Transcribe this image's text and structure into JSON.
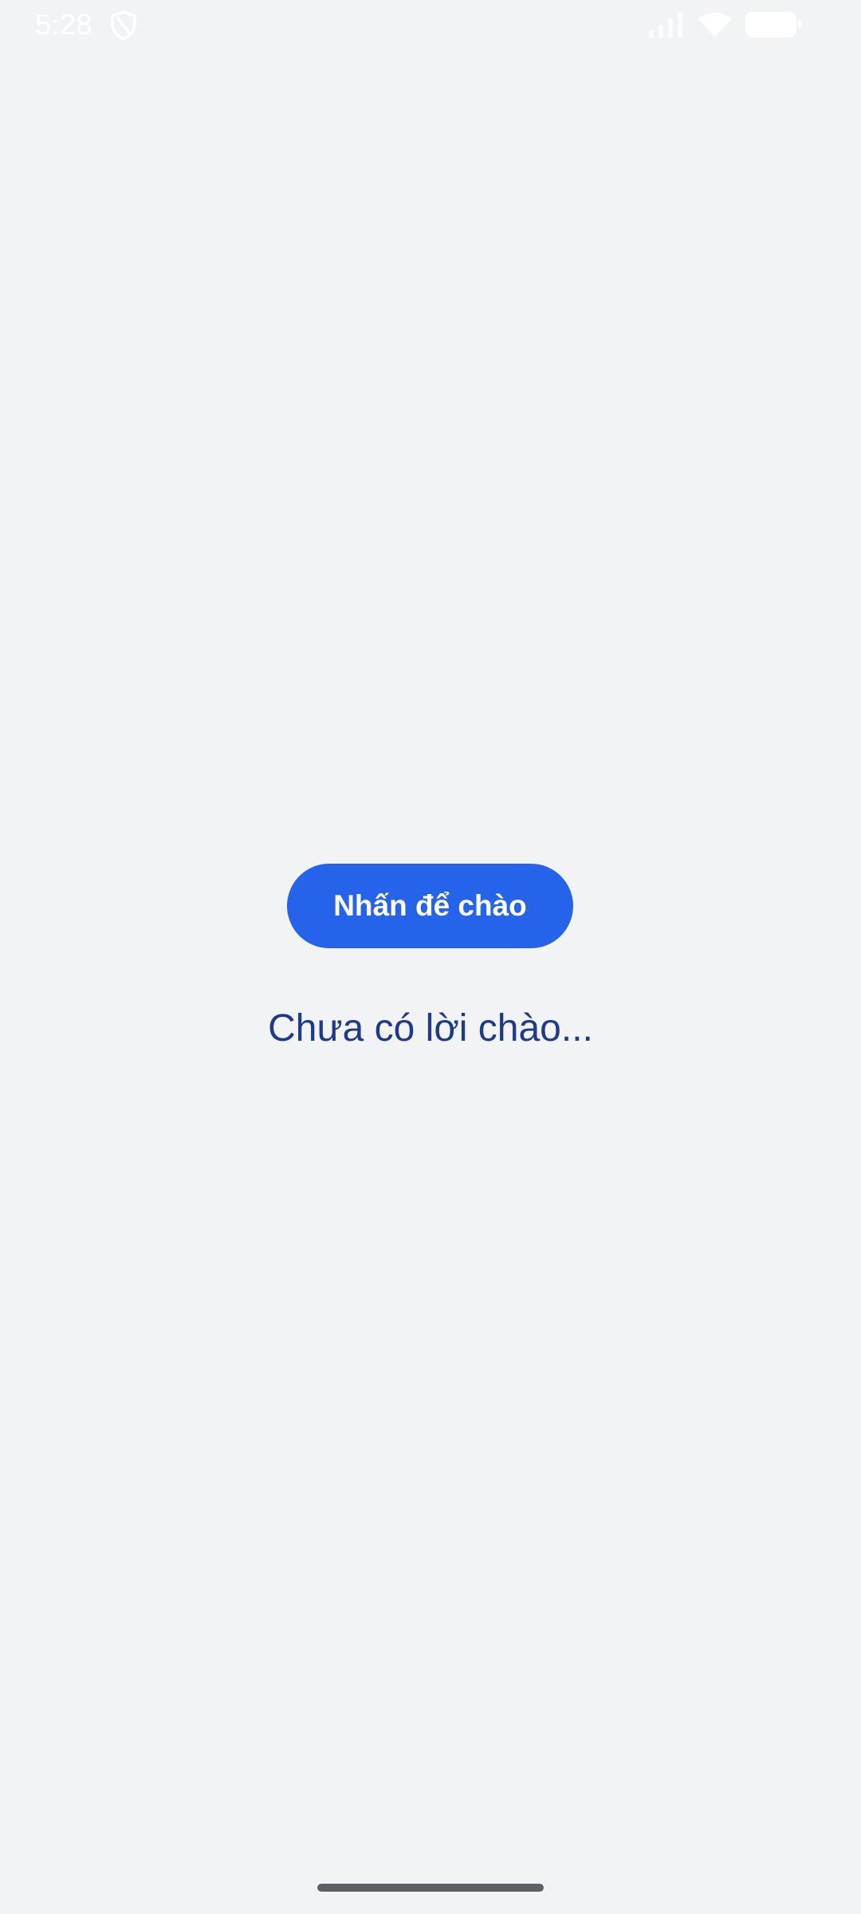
{
  "status_bar": {
    "time": "5:28",
    "icons": [
      "shield-icon",
      "signal-icon",
      "wifi-icon",
      "battery-icon"
    ]
  },
  "main": {
    "button_label": "Nhấn để chào",
    "message": "Chưa có lời chào..."
  },
  "colors": {
    "background": "#f2f3f5",
    "button": "#2563eb",
    "button_text": "#ffffff",
    "message_text": "#1e3a8a",
    "status_icons": "#ffffff",
    "home_indicator": "#5f6166"
  }
}
